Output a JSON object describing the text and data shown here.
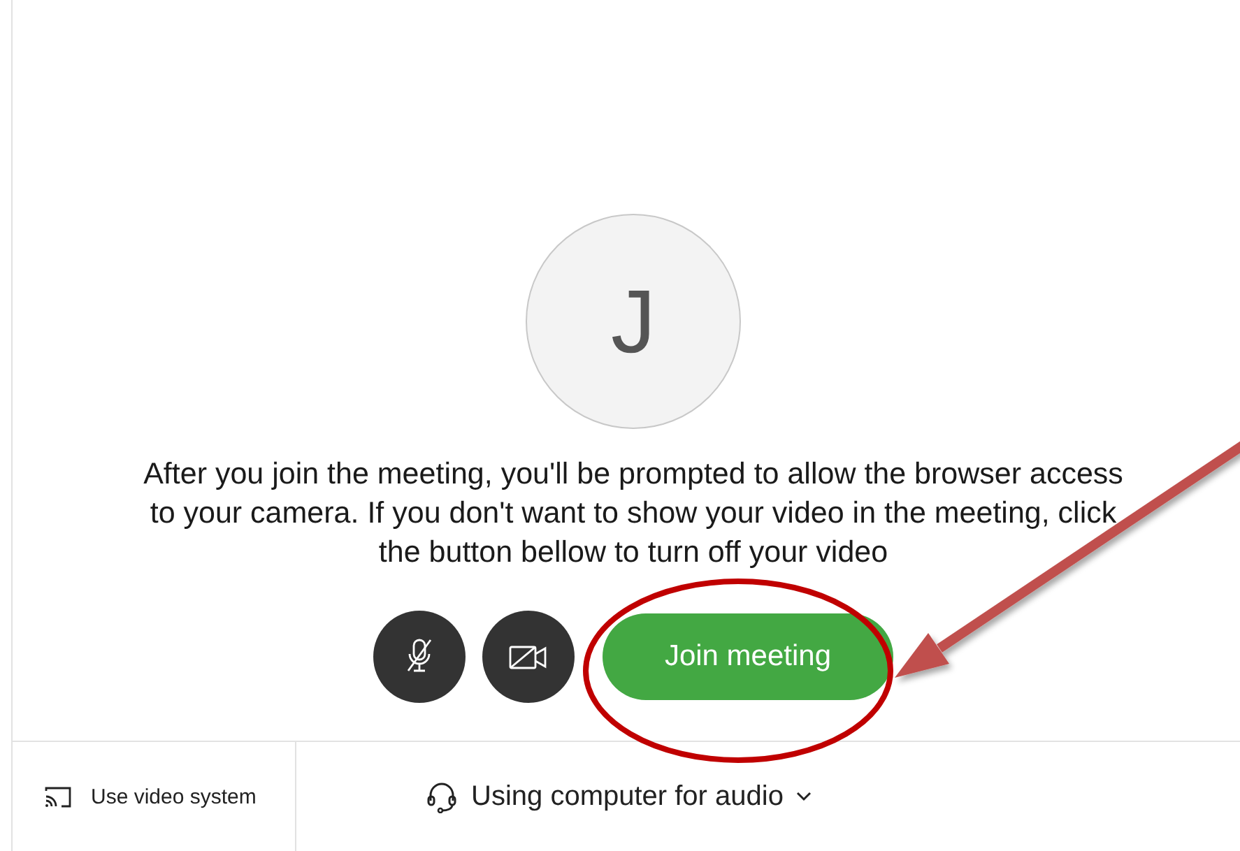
{
  "avatar": {
    "initial": "J"
  },
  "message": "After you join the meeting, you'll be prompted to allow the browser access to your camera. If you don't want to show your video in the meeting, click the button bellow to turn off your video",
  "controls": [
    {
      "kind": "microphone",
      "muted": true
    },
    {
      "kind": "camera",
      "muted": true
    }
  ],
  "join_button": {
    "label": "Join meeting"
  },
  "footer": {
    "video_system": "Use video system",
    "audio": "Using computer for audio"
  }
}
